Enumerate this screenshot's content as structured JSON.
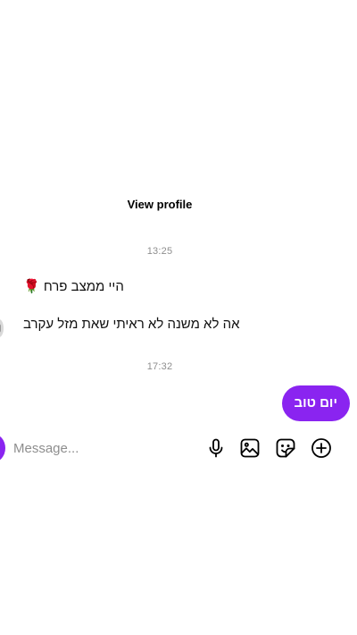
{
  "thread": {
    "view_profile_label": "View profile",
    "timestamp_1": "13:25",
    "timestamp_2": "17:32",
    "messages": [
      {
        "direction": "incoming",
        "text": "היי ממצב פרח 🌹"
      },
      {
        "direction": "incoming",
        "text": "אה לא משנה לא ראיתי שאת מזל עקרב"
      },
      {
        "direction": "outgoing",
        "text": "יום טוב"
      }
    ]
  },
  "composer": {
    "placeholder": "Message...",
    "icons": [
      "microphone-icon",
      "gallery-icon",
      "sticker-icon",
      "plus-icon"
    ]
  },
  "colors": {
    "accent": "#8a24f0",
    "timestamp": "#8e8e8e",
    "background": "#ffffff"
  }
}
